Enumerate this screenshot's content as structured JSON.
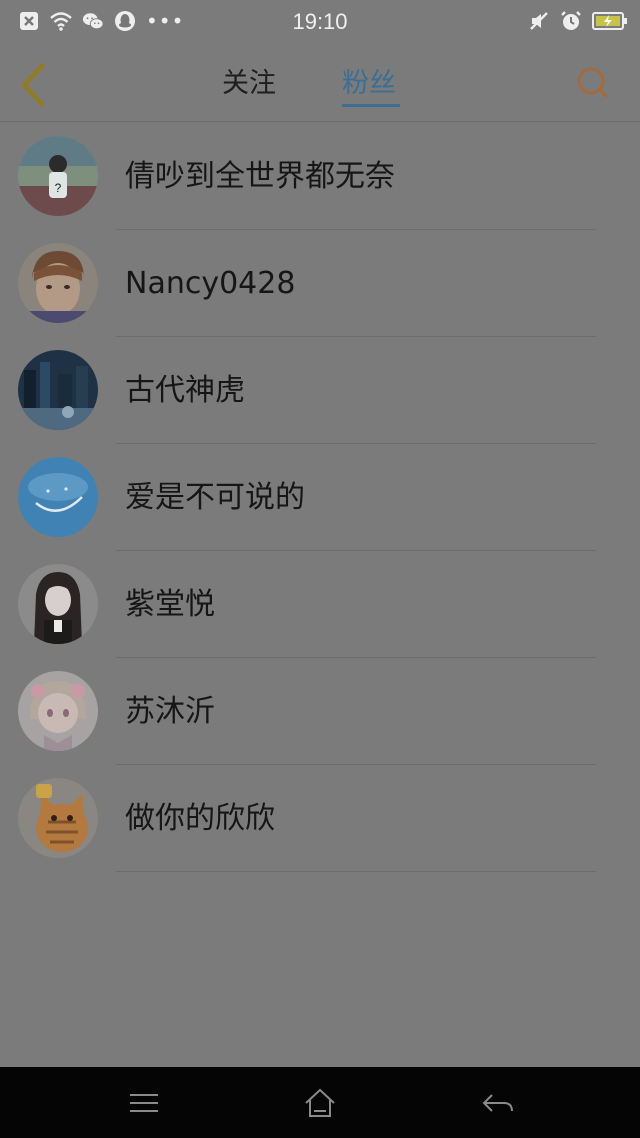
{
  "status_bar": {
    "time": "19:10",
    "left_icons": [
      "close-box-icon",
      "wifi-icon",
      "wechat-icon",
      "qq-icon",
      "more-dots-icon"
    ],
    "more_dots": "•••",
    "right_icons": [
      "mute-icon",
      "alarm-icon",
      "battery-charging-icon"
    ]
  },
  "header": {
    "tabs": [
      {
        "label": "关注",
        "active": false
      },
      {
        "label": "粉丝",
        "active": true
      }
    ],
    "active_color": "#3b6e93",
    "back_icon": "chevron-left-icon",
    "search_icon": "search-icon"
  },
  "fans": [
    {
      "name": "倩吵到全世界都无奈",
      "avatar": "avatar-girl-track"
    },
    {
      "name": "Nancy0428",
      "avatar": "avatar-boy-face"
    },
    {
      "name": "古代神虎",
      "avatar": "avatar-night-city"
    },
    {
      "name": "爱是不可说的",
      "avatar": "avatar-blue-smile"
    },
    {
      "name": "紫堂悦",
      "avatar": "avatar-anime-girl"
    },
    {
      "name": "苏沐沂",
      "avatar": "avatar-cartoon-girl"
    },
    {
      "name": "做你的欣欣",
      "avatar": "avatar-orange-cat"
    }
  ],
  "navbar": {
    "icons": [
      "menu-icon",
      "home-icon",
      "back-arrow-icon"
    ]
  }
}
